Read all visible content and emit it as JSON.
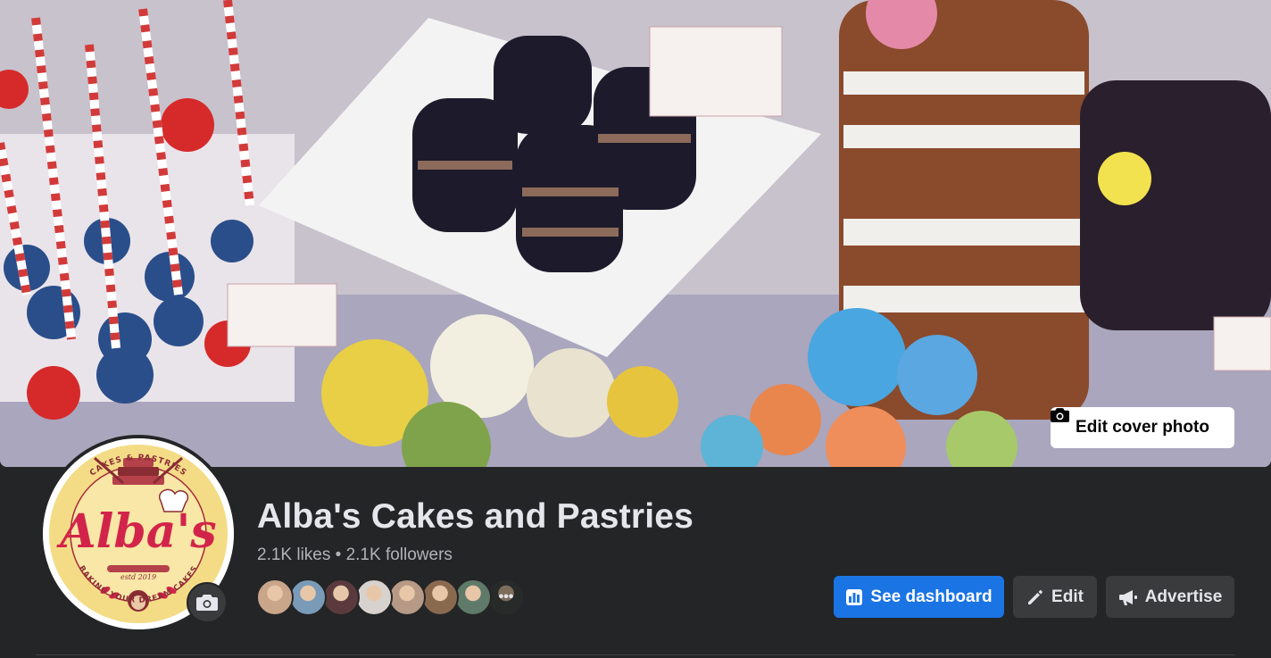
{
  "cover": {
    "edit_label": "Edit cover photo"
  },
  "profile": {
    "page_name": "Alba's Cakes and Pastries",
    "stats": "2.1K likes • 2.1K followers",
    "logo": {
      "name": "Alba's",
      "arc_top": "CAKES & PASTRIES",
      "arc_bottom": "BAKING YOUR DREAM CAKES",
      "est": "estd 2019"
    }
  },
  "followers_faces": [
    {
      "color": "#c9a58a"
    },
    {
      "color": "#7a9bb8"
    },
    {
      "color": "#5b3a3e"
    },
    {
      "color": "#d8d2cf"
    },
    {
      "color": "#b79a86"
    },
    {
      "color": "#8a6a4f"
    },
    {
      "color": "#5f7a68"
    },
    {
      "color": "#4a4b4c"
    }
  ],
  "actions": {
    "dashboard": "See dashboard",
    "edit": "Edit",
    "advertise": "Advertise"
  },
  "colors": {
    "background": "#242526",
    "primary": "#1b74e4",
    "secondary_button": "#3a3b3c",
    "text_primary": "#e4e6eb",
    "text_secondary": "#b0b3b8"
  }
}
